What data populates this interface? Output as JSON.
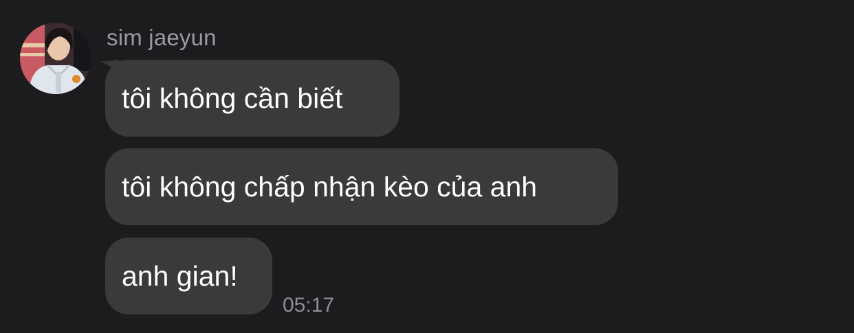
{
  "sender": {
    "name": "sim jaeyun"
  },
  "messages": [
    {
      "text": "tôi không cần biết"
    },
    {
      "text": "tôi không chấp nhận kèo của anh"
    },
    {
      "text": "anh gian!"
    }
  ],
  "timestamp": "05:17",
  "colors": {
    "background": "#1c1c1e",
    "bubble": "#3a3a3c",
    "bubble_text": "#ffffff",
    "sender_name": "#9a9aa0",
    "timestamp": "#8e8e93"
  },
  "icons": {
    "avatar": "profile-photo"
  }
}
